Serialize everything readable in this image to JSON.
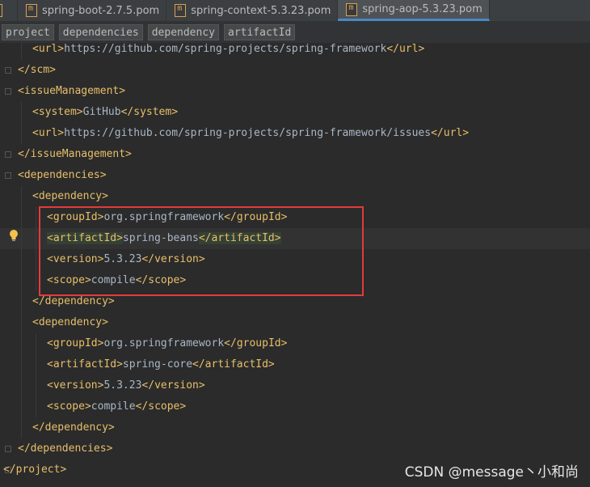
{
  "tabs": [
    {
      "label": "",
      "active": false
    },
    {
      "label": "spring-boot-2.7.5.pom",
      "active": false
    },
    {
      "label": "spring-context-5.3.23.pom",
      "active": false
    },
    {
      "label": "spring-aop-5.3.23.pom",
      "active": true
    }
  ],
  "breadcrumbs": [
    "project",
    "dependencies",
    "dependency",
    "artifactId"
  ],
  "code": {
    "l1_open": "<url>",
    "l1_val": "https://github.com/spring-projects/spring-framework",
    "l1_close": "</url>",
    "l2": "</scm>",
    "l3": "<issueManagement>",
    "l4_open": "<system>",
    "l4_val": "GitHub",
    "l4_close": "</system>",
    "l5_open": "<url>",
    "l5_val": "https://github.com/spring-projects/spring-framework/issues",
    "l5_close": "</url>",
    "l6": "</issueManagement>",
    "l7": "<dependencies>",
    "l8": "<dependency>",
    "l9_open": "<groupId>",
    "l9_val": "org.springframework",
    "l9_close": "</groupId>",
    "l10_open": "<artifactId>",
    "l10_val": "spring-beans",
    "l10_close": "</artifactId>",
    "l11_open": "<version>",
    "l11_val": "5.3.23",
    "l11_close": "</version>",
    "l12_open": "<scope>",
    "l12_val": "compile",
    "l12_close": "</scope>",
    "l13": "</dependency>",
    "l14": "<dependency>",
    "l15_open": "<groupId>",
    "l15_val": "org.springframework",
    "l15_close": "</groupId>",
    "l16_open": "<artifactId>",
    "l16_val": "spring-core",
    "l16_close": "</artifactId>",
    "l17_open": "<version>",
    "l17_val": "5.3.23",
    "l17_close": "</version>",
    "l18_open": "<scope>",
    "l18_val": "compile",
    "l18_close": "</scope>",
    "l19": "</dependency>",
    "l20": "</dependencies>",
    "l21": "</project>"
  },
  "watermark": "CSDN @message丶小和尚",
  "colors": {
    "tag": "#e8bf6a",
    "text": "#a9b7c6",
    "highlight_box": "#e23b3b",
    "active_tab_underline": "#4a88c7"
  }
}
